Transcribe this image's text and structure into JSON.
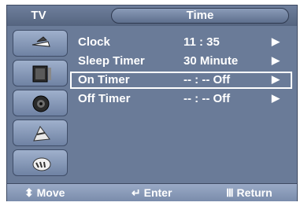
{
  "header": {
    "source_label": "TV",
    "title": "Time"
  },
  "sidebar": {
    "items": [
      {
        "icon": "antenna-icon"
      },
      {
        "icon": "picture-icon"
      },
      {
        "icon": "speaker-icon"
      },
      {
        "icon": "channel-icon"
      },
      {
        "icon": "setup-icon"
      }
    ]
  },
  "menu": {
    "items": [
      {
        "label": "Clock",
        "value": "11 : 35",
        "arrow": "▶",
        "selected": false
      },
      {
        "label": "Sleep Timer",
        "value": "30 Minute",
        "arrow": "▶",
        "selected": false
      },
      {
        "label": "On Timer",
        "value": "-- : --   Off",
        "arrow": "▶",
        "selected": true
      },
      {
        "label": "Off Timer",
        "value": "-- : --   Off",
        "arrow": "▶",
        "selected": false
      }
    ]
  },
  "footer": {
    "move": {
      "icon": "updown-arrows-icon",
      "label": "Move"
    },
    "enter": {
      "icon": "enter-icon",
      "label": "Enter"
    },
    "return": {
      "icon": "return-icon",
      "label": "Return"
    }
  },
  "colors": {
    "background": "#6a7b98",
    "text": "#ffffff",
    "selection_border": "#ffffff"
  }
}
